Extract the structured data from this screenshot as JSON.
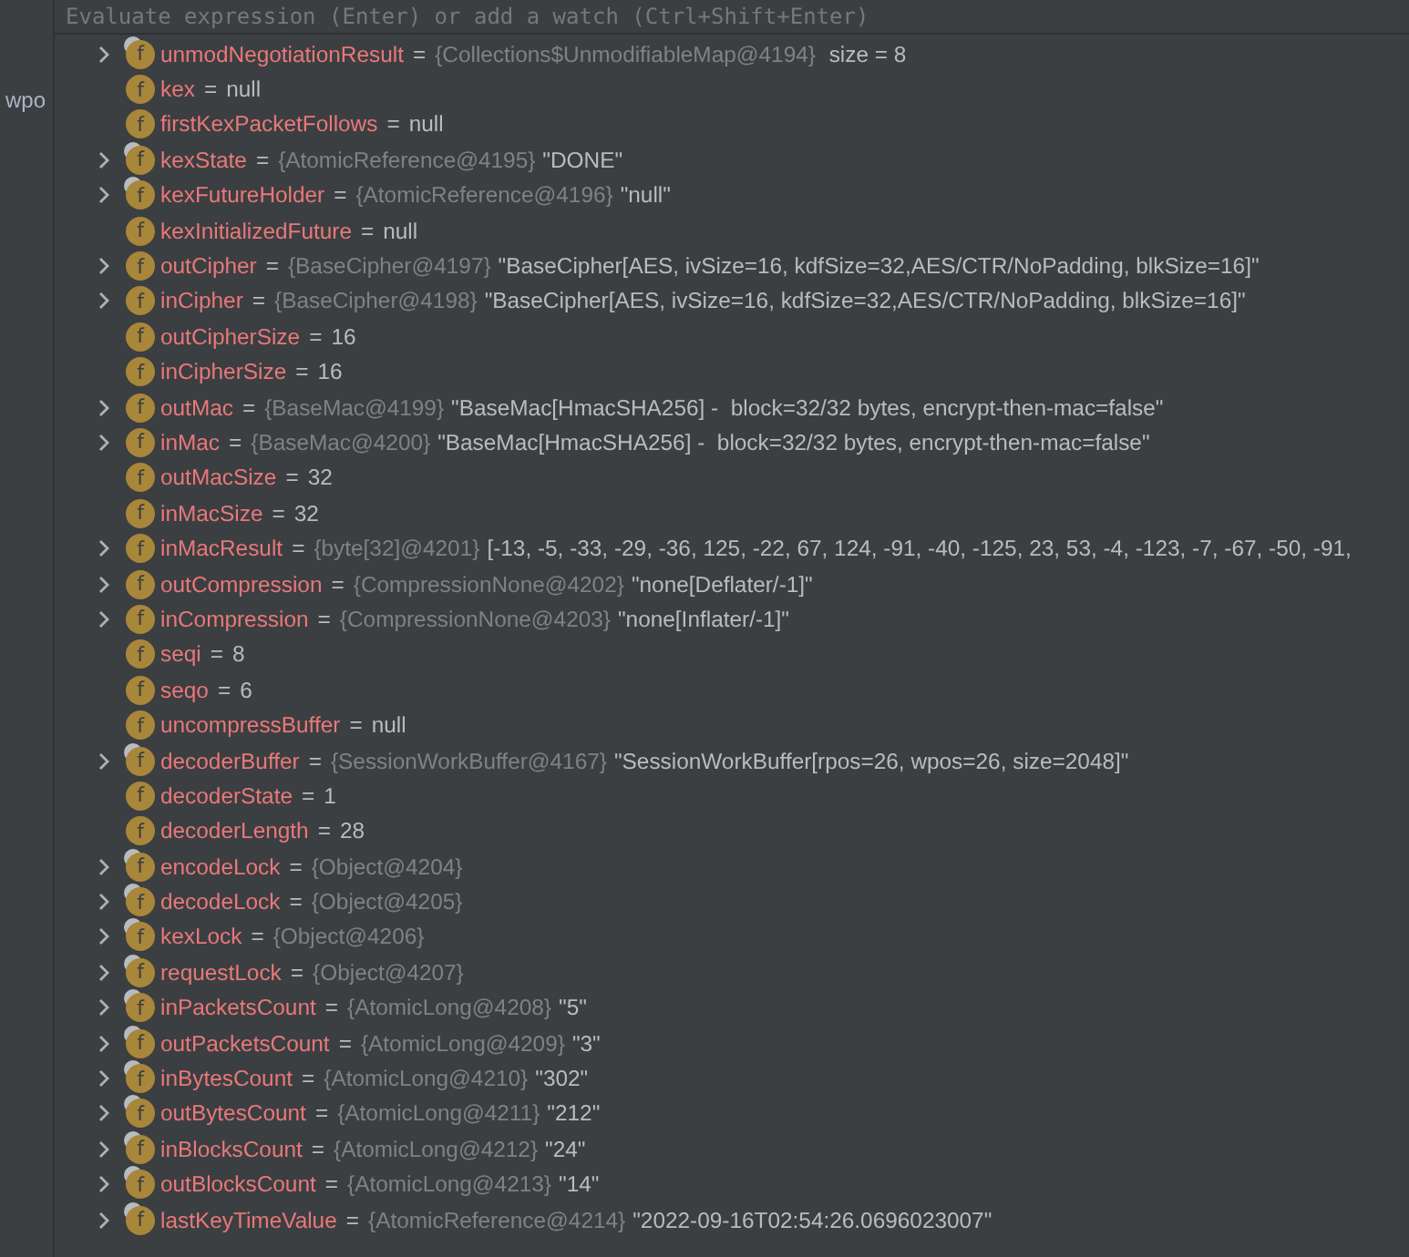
{
  "gutter": {
    "text": "wpo"
  },
  "watch_field": {
    "placeholder": "Evaluate expression (Enter) or add a watch (Ctrl+Shift+Enter)"
  },
  "variables": [
    {
      "expandable": true,
      "final": true,
      "icon": "f",
      "name": "unmodNegotiationResult",
      "eq": "=",
      "type": "{Collections$UnmodifiableMap@4194}",
      "value": " size = 8"
    },
    {
      "expandable": false,
      "final": false,
      "icon": "f",
      "name": "kex",
      "eq": "=",
      "value": "null"
    },
    {
      "expandable": false,
      "final": false,
      "icon": "f",
      "name": "firstKexPacketFollows",
      "eq": "=",
      "value": "null"
    },
    {
      "expandable": true,
      "final": true,
      "icon": "f",
      "name": "kexState",
      "eq": "=",
      "type": "{AtomicReference@4195}",
      "value": "\"DONE\""
    },
    {
      "expandable": true,
      "final": true,
      "icon": "f",
      "name": "kexFutureHolder",
      "eq": "=",
      "type": "{AtomicReference@4196}",
      "value": "\"null\""
    },
    {
      "expandable": false,
      "final": false,
      "icon": "f",
      "name": "kexInitializedFuture",
      "eq": "=",
      "value": "null"
    },
    {
      "expandable": true,
      "final": false,
      "icon": "f",
      "name": "outCipher",
      "eq": "=",
      "type": "{BaseCipher@4197}",
      "value": "\"BaseCipher[AES, ivSize=16, kdfSize=32,AES/CTR/NoPadding, blkSize=16]\""
    },
    {
      "expandable": true,
      "final": false,
      "icon": "f",
      "name": "inCipher",
      "eq": "=",
      "type": "{BaseCipher@4198}",
      "value": "\"BaseCipher[AES, ivSize=16, kdfSize=32,AES/CTR/NoPadding, blkSize=16]\""
    },
    {
      "expandable": false,
      "final": false,
      "icon": "f",
      "name": "outCipherSize",
      "eq": "=",
      "value": "16"
    },
    {
      "expandable": false,
      "final": false,
      "icon": "f",
      "name": "inCipherSize",
      "eq": "=",
      "value": "16"
    },
    {
      "expandable": true,
      "final": false,
      "icon": "f",
      "name": "outMac",
      "eq": "=",
      "type": "{BaseMac@4199}",
      "value": "\"BaseMac[HmacSHA256] -  block=32/32 bytes, encrypt-then-mac=false\""
    },
    {
      "expandable": true,
      "final": false,
      "icon": "f",
      "name": "inMac",
      "eq": "=",
      "type": "{BaseMac@4200}",
      "value": "\"BaseMac[HmacSHA256] -  block=32/32 bytes, encrypt-then-mac=false\""
    },
    {
      "expandable": false,
      "final": false,
      "icon": "f",
      "name": "outMacSize",
      "eq": "=",
      "value": "32"
    },
    {
      "expandable": false,
      "final": false,
      "icon": "f",
      "name": "inMacSize",
      "eq": "=",
      "value": "32"
    },
    {
      "expandable": true,
      "final": false,
      "icon": "f",
      "name": "inMacResult",
      "eq": "=",
      "type": "{byte[32]@4201}",
      "value": "[-13, -5, -33, -29, -36, 125, -22, 67, 124, -91, -40, -125, 23, 53, -4, -123, -7, -67, -50, -91,"
    },
    {
      "expandable": true,
      "final": false,
      "icon": "f",
      "name": "outCompression",
      "eq": "=",
      "type": "{CompressionNone@4202}",
      "value": "\"none[Deflater/-1]\""
    },
    {
      "expandable": true,
      "final": false,
      "icon": "f",
      "name": "inCompression",
      "eq": "=",
      "type": "{CompressionNone@4203}",
      "value": "\"none[Inflater/-1]\""
    },
    {
      "expandable": false,
      "final": false,
      "icon": "f",
      "name": "seqi",
      "eq": "=",
      "value": "8"
    },
    {
      "expandable": false,
      "final": false,
      "icon": "f",
      "name": "seqo",
      "eq": "=",
      "value": "6"
    },
    {
      "expandable": false,
      "final": false,
      "icon": "f",
      "name": "uncompressBuffer",
      "eq": "=",
      "value": "null"
    },
    {
      "expandable": true,
      "final": true,
      "icon": "f",
      "name": "decoderBuffer",
      "eq": "=",
      "type": "{SessionWorkBuffer@4167}",
      "value": "\"SessionWorkBuffer[rpos=26, wpos=26, size=2048]\""
    },
    {
      "expandable": false,
      "final": false,
      "icon": "f",
      "name": "decoderState",
      "eq": "=",
      "value": "1"
    },
    {
      "expandable": false,
      "final": false,
      "icon": "f",
      "name": "decoderLength",
      "eq": "=",
      "value": "28"
    },
    {
      "expandable": true,
      "final": true,
      "icon": "f",
      "name": "encodeLock",
      "eq": "=",
      "type": "{Object@4204}"
    },
    {
      "expandable": true,
      "final": true,
      "icon": "f",
      "name": "decodeLock",
      "eq": "=",
      "type": "{Object@4205}"
    },
    {
      "expandable": true,
      "final": true,
      "icon": "f",
      "name": "kexLock",
      "eq": "=",
      "type": "{Object@4206}"
    },
    {
      "expandable": true,
      "final": true,
      "icon": "f",
      "name": "requestLock",
      "eq": "=",
      "type": "{Object@4207}"
    },
    {
      "expandable": true,
      "final": true,
      "icon": "f",
      "name": "inPacketsCount",
      "eq": "=",
      "type": "{AtomicLong@4208}",
      "value": "\"5\""
    },
    {
      "expandable": true,
      "final": true,
      "icon": "f",
      "name": "outPacketsCount",
      "eq": "=",
      "type": "{AtomicLong@4209}",
      "value": "\"3\""
    },
    {
      "expandable": true,
      "final": true,
      "icon": "f",
      "name": "inBytesCount",
      "eq": "=",
      "type": "{AtomicLong@4210}",
      "value": "\"302\""
    },
    {
      "expandable": true,
      "final": true,
      "icon": "f",
      "name": "outBytesCount",
      "eq": "=",
      "type": "{AtomicLong@4211}",
      "value": "\"212\""
    },
    {
      "expandable": true,
      "final": true,
      "icon": "f",
      "name": "inBlocksCount",
      "eq": "=",
      "type": "{AtomicLong@4212}",
      "value": "\"24\""
    },
    {
      "expandable": true,
      "final": true,
      "icon": "f",
      "name": "outBlocksCount",
      "eq": "=",
      "type": "{AtomicLong@4213}",
      "value": "\"14\""
    },
    {
      "expandable": true,
      "final": true,
      "icon": "f",
      "name": "lastKeyTimeValue",
      "eq": "=",
      "type": "{AtomicReference@4214}",
      "value": "\"2022-09-16T02:54:26.0696023007\""
    }
  ]
}
